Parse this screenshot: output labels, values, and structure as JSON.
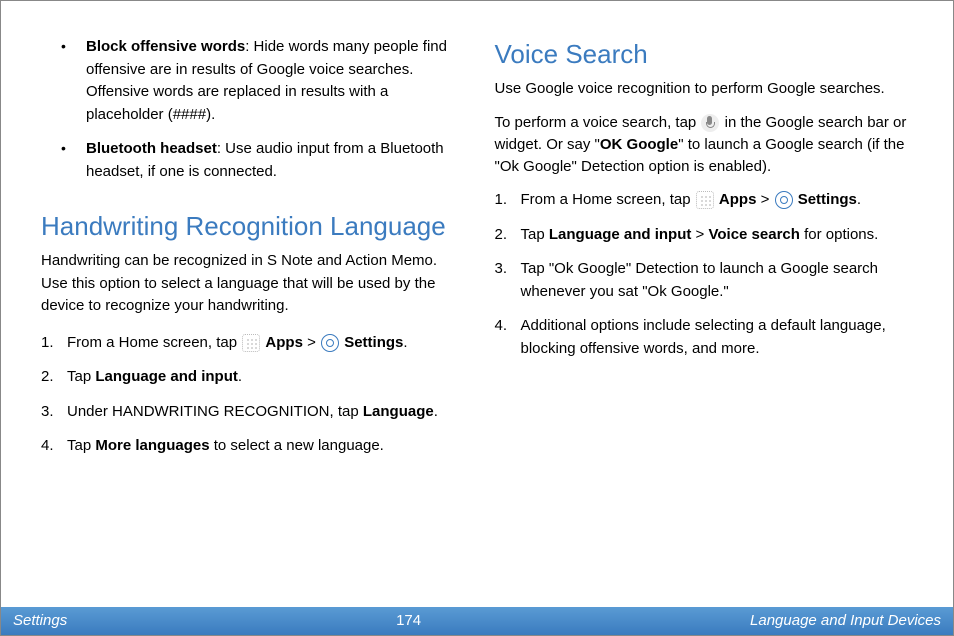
{
  "leftColumn": {
    "bullets": [
      {
        "label": "Block offensive words",
        "text": ": Hide words many people find offensive are in results of Google voice searches. Offensive words are replaced in results with a placeholder (####)."
      },
      {
        "label": "Bluetooth headset",
        "text": ": Use audio input from a Bluetooth headset, if one is connected."
      }
    ],
    "heading": "Handwriting Recognition Language",
    "intro": "Handwriting can be recognized in S Note and Action Memo. Use this option to select a language that will be used by the device to recognize your handwriting.",
    "steps": {
      "s1_prefix": "From a Home screen, tap ",
      "s1_apps": "Apps",
      "s1_gt": " > ",
      "s1_settings": "Settings",
      "s1_end": ".",
      "s2_prefix": "Tap ",
      "s2_bold": "Language and input",
      "s2_end": ".",
      "s3_prefix": "Under HANDWRITING RECOGNITION, tap ",
      "s3_bold": "Language",
      "s3_end": ".",
      "s4_prefix": "Tap ",
      "s4_bold": "More languages",
      "s4_end": " to select a new language."
    },
    "nums": {
      "n1": "1.",
      "n2": "2.",
      "n3": "3.",
      "n4": "4."
    }
  },
  "rightColumn": {
    "heading": "Voice Search",
    "intro": "Use Google voice recognition to perform Google searches.",
    "para2_prefix": "To perform a voice search, tap ",
    "para2_mid": " in the Google search bar or widget. Or say \"",
    "para2_bold": "OK Google",
    "para2_end": "\" to launch a Google search (if the \"Ok Google\" Detection option is enabled).",
    "steps": {
      "s1_prefix": "From a Home screen, tap ",
      "s1_apps": "Apps",
      "s1_gt": " > ",
      "s1_settings": "Settings",
      "s1_end": ".",
      "s2_prefix": "Tap ",
      "s2_bold1": "Language and input",
      "s2_gt": " > ",
      "s2_bold2": "Voice search",
      "s2_end": " for options.",
      "s3": "Tap \"Ok Google\" Detection to launch a Google search whenever you sat \"Ok Google.\"",
      "s4": "Additional options include selecting a default language, blocking offensive words, and more."
    },
    "nums": {
      "n1": "1.",
      "n2": "2.",
      "n3": "3.",
      "n4": "4."
    }
  },
  "footer": {
    "left": "Settings",
    "page": "174",
    "right": "Language and Input Devices"
  }
}
